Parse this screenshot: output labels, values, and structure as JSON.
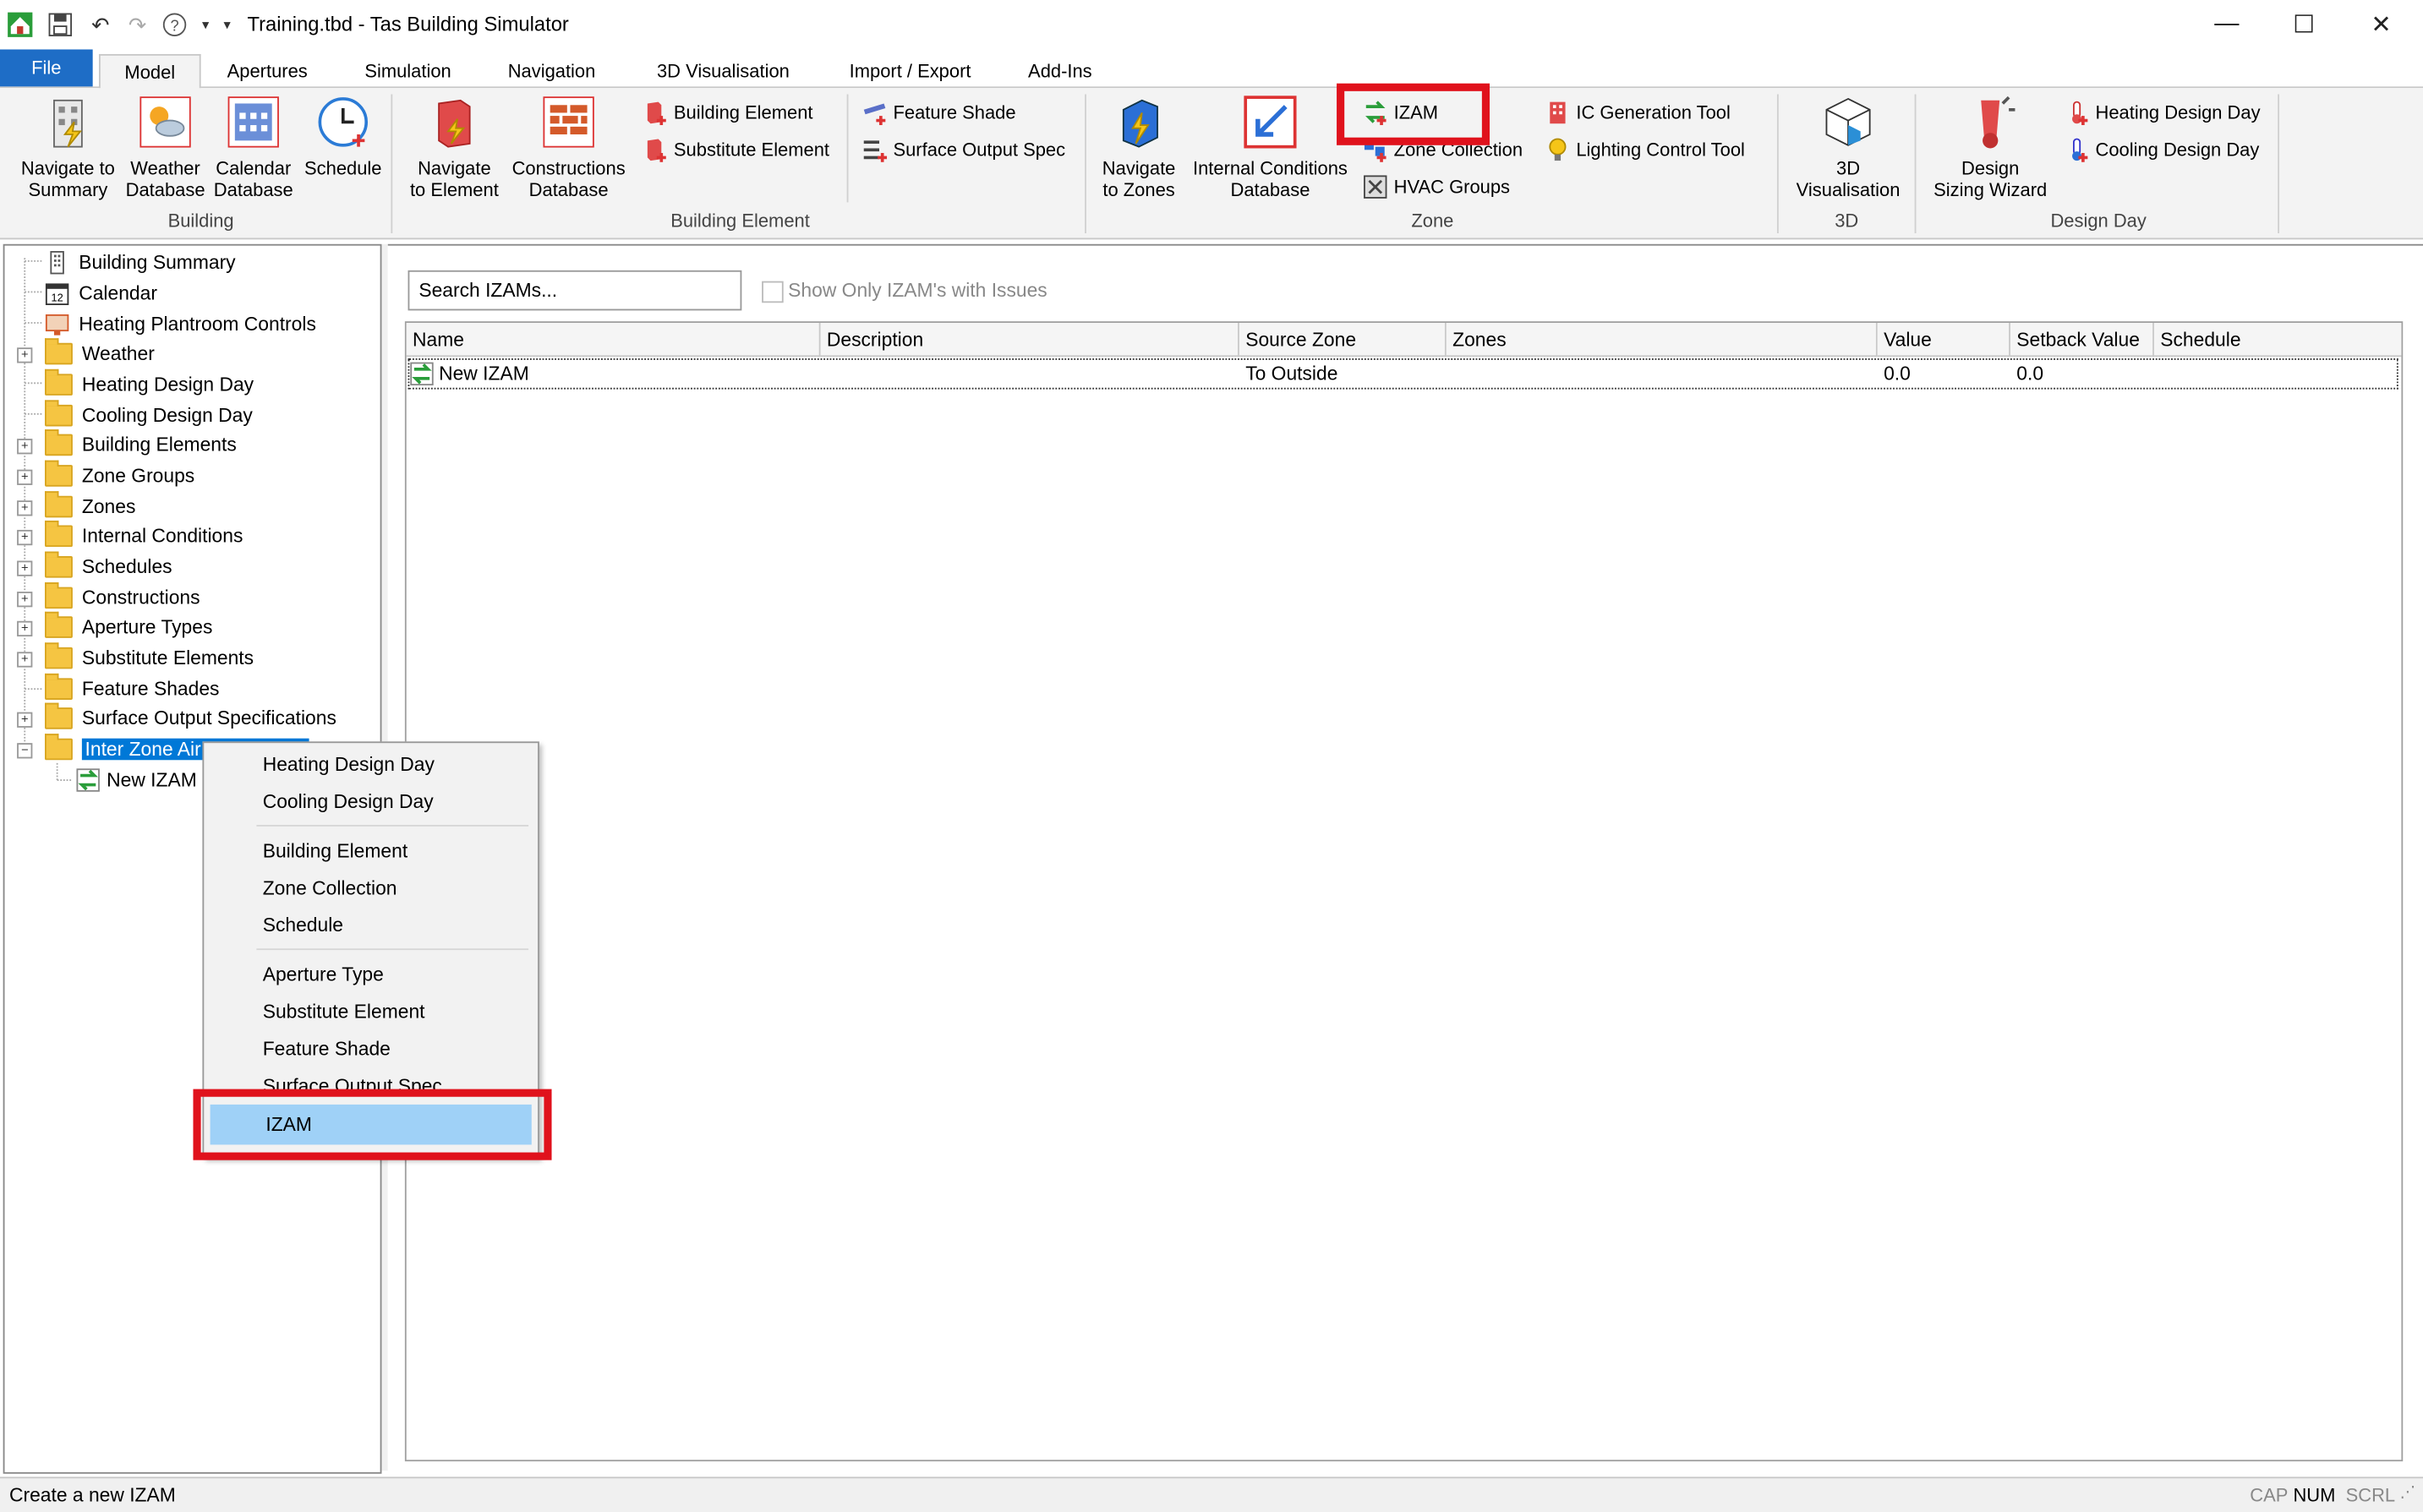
{
  "window": {
    "title": "Training.tbd - Tas Building Simulator",
    "minimize": "—",
    "maximize": "☐",
    "close": "✕"
  },
  "tabs": [
    {
      "label": "File"
    },
    {
      "label": "Model"
    },
    {
      "label": "Apertures"
    },
    {
      "label": "Simulation"
    },
    {
      "label": "Navigation"
    },
    {
      "label": "3D Visualisation"
    },
    {
      "label": "Import / Export"
    },
    {
      "label": "Add-Ins"
    }
  ],
  "ribbon": {
    "building": {
      "group": "Building",
      "navigate_summary": [
        "Navigate to",
        "Summary"
      ],
      "weather_db": [
        "Weather",
        "Database"
      ],
      "calendar_db": [
        "Calendar",
        "Database"
      ],
      "schedule": [
        "Schedule",
        ""
      ]
    },
    "building_element": {
      "group": "Building Element",
      "navigate_element": [
        "Navigate",
        "to Element"
      ],
      "constructions_db": [
        "Constructions",
        "Database"
      ],
      "building_element": "Building Element",
      "substitute_element": "Substitute Element",
      "feature_shade": "Feature Shade",
      "surface_output_spec": "Surface Output Spec"
    },
    "zone": {
      "group": "Zone",
      "navigate_zones": [
        "Navigate",
        "to Zones"
      ],
      "ic_db": [
        "Internal Conditions",
        "Database"
      ],
      "izam": "IZAM",
      "zone_collection": "Zone Collection",
      "hvac_groups": "HVAC Groups",
      "ic_generation_tool": "IC Generation Tool",
      "lighting_control_tool": "Lighting Control Tool"
    },
    "three_d": {
      "group": "3D",
      "visualisation": [
        "3D",
        "Visualisation"
      ]
    },
    "design_day": {
      "group": "Design Day",
      "sizing_wizard": [
        "Design",
        "Sizing Wizard"
      ],
      "heating": "Heating Design Day",
      "cooling": "Cooling Design Day"
    }
  },
  "tree": {
    "building_summary": "Building Summary",
    "calendar": "Calendar",
    "heating_plantroom": "Heating Plantroom Controls",
    "weather": "Weather",
    "heating_design_day": "Heating Design Day",
    "cooling_design_day": "Cooling Design Day",
    "building_elements": "Building Elements",
    "zone_groups": "Zone Groups",
    "zones": "Zones",
    "internal_conditions": "Internal Conditions",
    "schedules": "Schedules",
    "constructions": "Constructions",
    "aperture_types": "Aperture Types",
    "substitute_elements": "Substitute Elements",
    "feature_shades": "Feature Shades",
    "surface_output_specs": "Surface Output Specifications",
    "inter_zone_air": "Inter Zone Air",
    "new_izam": "New IZAM"
  },
  "main": {
    "search_placeholder": "Search IZAMs...",
    "show_only_issues": "Show Only IZAM's with Issues",
    "columns": {
      "name": "Name",
      "description": "Description",
      "source_zone": "Source Zone",
      "zones": "Zones",
      "value": "Value",
      "setback_value": "Setback Value",
      "schedule": "Schedule"
    },
    "row": {
      "name": "New IZAM",
      "description": "",
      "source_zone": "To Outside",
      "zones": "",
      "value": "0.0",
      "setback_value": "0.0",
      "schedule": ""
    }
  },
  "context_menu": {
    "heating_design_day": "Heating Design Day",
    "cooling_design_day": "Cooling Design Day",
    "building_element": "Building Element",
    "zone_collection": "Zone Collection",
    "schedule": "Schedule",
    "aperture_type": "Aperture Type",
    "substitute_element": "Substitute Element",
    "feature_shade": "Feature Shade",
    "surface_output_spec": "Surface Output Spec",
    "izam": "IZAM"
  },
  "status": {
    "text": "Create a new IZAM",
    "cap": "CAP",
    "num": "NUM",
    "scrl": "SCRL"
  },
  "colors": {
    "file_tab": "#1e6dc6",
    "highlight_box": "#e0121c",
    "menu_hover": "#9fd1f7",
    "tree_selection": "#0078d7"
  }
}
